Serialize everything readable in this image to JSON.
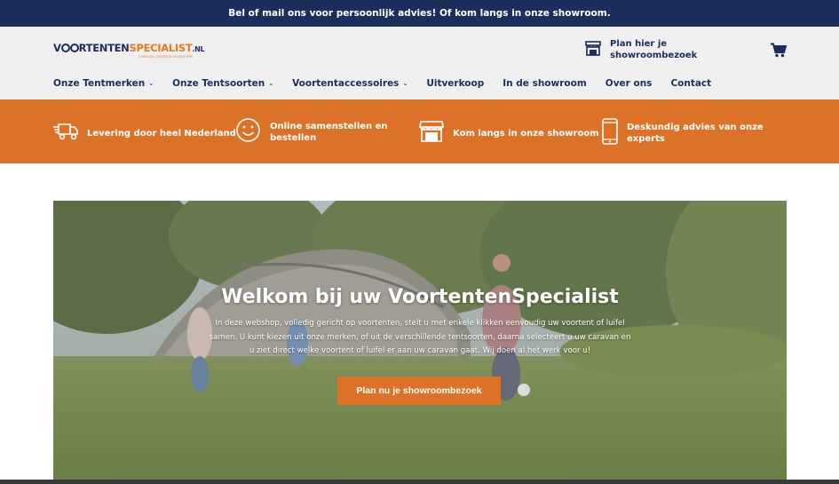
{
  "topbar": {
    "text": "Bel of mail ons voor persoonlijk advies! Of kom langs in onze showroom."
  },
  "logo": {
    "part1": "V",
    "part2": "RTENTEN",
    "part3": "SPECIALIST",
    "suffix": ".NL",
    "tagline": "CARAVAN CENTRUM MEERVORM"
  },
  "header": {
    "plan_line1": "Plan hier je",
    "plan_line2": "showroombezoek",
    "plan_icon": "storefront-icon",
    "cart_icon": "cart-icon"
  },
  "nav": [
    {
      "label": "Onze Tentmerken",
      "dropdown": true
    },
    {
      "label": "Onze Tentsoorten",
      "dropdown": true
    },
    {
      "label": "Voortentaccessoires",
      "dropdown": true
    },
    {
      "label": "Uitverkoop",
      "dropdown": false
    },
    {
      "label": "In de showroom",
      "dropdown": false
    },
    {
      "label": "Over ons",
      "dropdown": false
    },
    {
      "label": "Contact",
      "dropdown": false
    }
  ],
  "usp": [
    {
      "line1": "Levering door heel Nederland",
      "line2": "",
      "icon": "delivery-truck-icon"
    },
    {
      "line1": "Online samenstellen en",
      "line2": "bestellen",
      "icon": "smiley-icon"
    },
    {
      "line1": "Kom langs in onze showroom",
      "line2": "",
      "icon": "storefront-icon"
    },
    {
      "line1": "Deskundig advies van onze",
      "line2": "experts",
      "icon": "phone-icon"
    }
  ],
  "hero": {
    "title": "Welkom bij uw VoortentenSpecialist",
    "text": "In deze webshop, volledig gericht op voortenten, stelt u met enkele klikken eenvoudig uw voortent of luifel samen. U kunt kiezen uit onze merken, of uit de verschillende tentsoorten, daarna selecteert u uw caravan en u ziet direct welke voortent of luifel er aan uw caravan gaat. Wij doen al het werk voor u!",
    "button": "Plan nu je showroombezoek"
  },
  "colors": {
    "navy": "#1d2d5c",
    "orange": "#dc7228",
    "header_bg": "#efefef"
  }
}
